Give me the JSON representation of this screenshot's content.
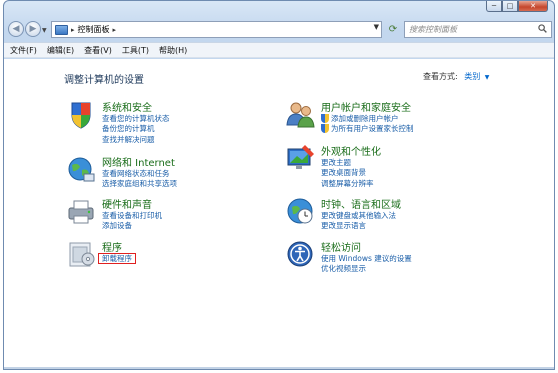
{
  "window": {
    "caption": {
      "minimize": "─",
      "maximize": "□",
      "close": "✕"
    }
  },
  "address": {
    "breadcrumb": [
      "控制面板"
    ],
    "search_placeholder": "搜索控制面板"
  },
  "menu": [
    "文件(F)",
    "编辑(E)",
    "查看(V)",
    "工具(T)",
    "帮助(H)"
  ],
  "content": {
    "heading": "调整计算机的设置",
    "view_by_label": "查看方式:",
    "view_by_value": "类别"
  },
  "categories": {
    "system": {
      "title": "系统和安全",
      "links": [
        "查看您的计算机状态",
        "备份您的计算机",
        "查找并解决问题"
      ]
    },
    "network": {
      "title": "网络和 Internet",
      "links": [
        "查看网络状态和任务",
        "选择家庭组和共享选项"
      ]
    },
    "hardware": {
      "title": "硬件和声音",
      "links": [
        "查看设备和打印机",
        "添加设备"
      ]
    },
    "programs": {
      "title": "程序",
      "links": [
        "卸载程序"
      ]
    },
    "users": {
      "title": "用户帐户和家庭安全",
      "links": [
        "添加或删除用户帐户",
        "为所有用户设置家长控制"
      ]
    },
    "appearance": {
      "title": "外观和个性化",
      "links": [
        "更改主题",
        "更改桌面背景",
        "调整屏幕分辨率"
      ]
    },
    "clock": {
      "title": "时钟、语言和区域",
      "links": [
        "更改键盘或其他输入法",
        "更改显示语言"
      ]
    },
    "access": {
      "title": "轻松访问",
      "links": [
        "使用 Windows 建议的设置",
        "优化视频显示"
      ]
    }
  },
  "colors": {
    "category_title": "#1a6d1a",
    "link": "#1a5ea8",
    "highlight_box": "#e02020"
  },
  "icons": [
    "back-arrow-icon",
    "forward-arrow-icon",
    "control-panel-icon",
    "refresh-icon",
    "search-icon",
    "shield-icon"
  ]
}
